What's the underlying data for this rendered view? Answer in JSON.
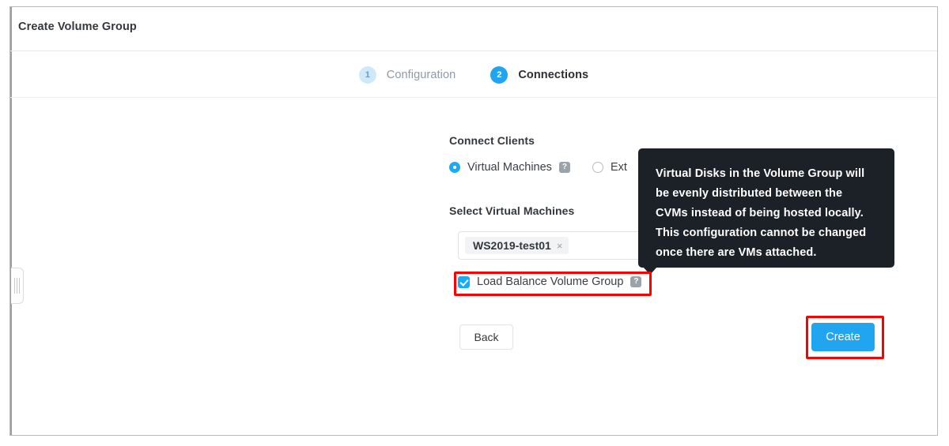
{
  "window": {
    "title": "Create Volume Group"
  },
  "stepper": {
    "steps": [
      {
        "number": "1",
        "label": "Configuration",
        "state": "inactive"
      },
      {
        "number": "2",
        "label": "Connections",
        "state": "active"
      }
    ]
  },
  "form": {
    "connect_clients": {
      "label": "Connect Clients",
      "options": [
        {
          "label": "Virtual Machines",
          "selected": true,
          "help": "?"
        },
        {
          "label": "Ext",
          "selected": false
        }
      ]
    },
    "select_vms": {
      "label": "Select Virtual Machines",
      "tag": {
        "label": "WS2019-test01",
        "remove": "×"
      }
    },
    "load_balance": {
      "label": "Load Balance Volume Group",
      "checked": true,
      "help": "?"
    }
  },
  "buttons": {
    "back": "Back",
    "create": "Create"
  },
  "tooltip": {
    "text": "Virtual Disks in the Volume Group will be evenly distributed between the CVMs instead of being hosted locally. This configuration cannot be changed once there are VMs attached."
  },
  "colors": {
    "accent": "#22a5f1",
    "accent_light": "#cfe9fb",
    "checkbox": "#19aaf8",
    "tooltip_bg": "#1c2128",
    "annotation": "#ff0000",
    "title_text": "#34383c"
  }
}
